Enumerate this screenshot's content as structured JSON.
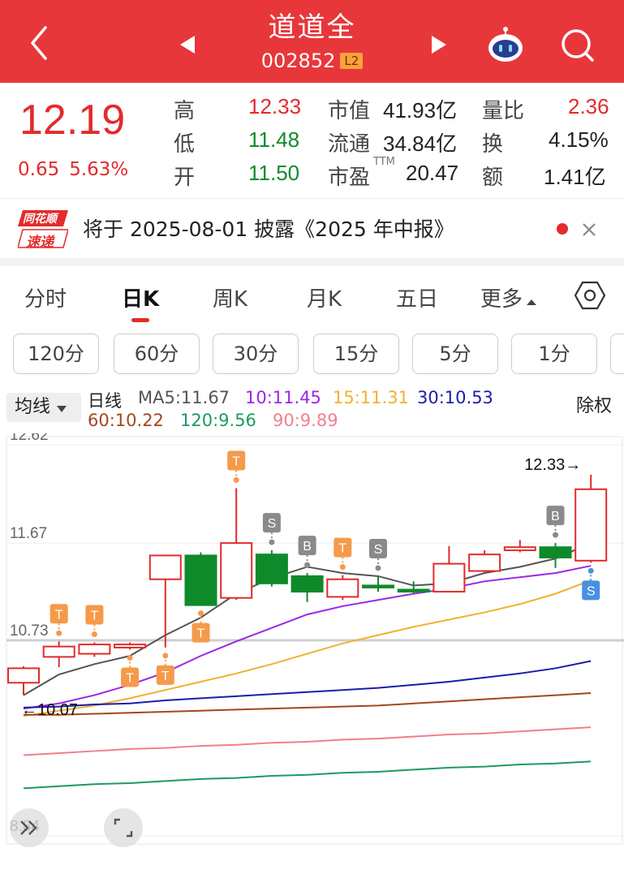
{
  "header": {
    "title": "道道全",
    "code": "002852",
    "badge": "L2",
    "icons": [
      "back-icon",
      "prev-stock-icon",
      "next-stock-icon",
      "robot-assistant-icon",
      "search-icon"
    ]
  },
  "quote": {
    "price": "12.19",
    "change": "0.65",
    "change_pct": "5.63%",
    "high_label": "高",
    "high": "12.33",
    "low_label": "低",
    "low": "11.48",
    "open_label": "开",
    "open": "11.50",
    "mktcap_label": "市值",
    "mktcap": "41.93亿",
    "float_label": "流通",
    "float": "34.84亿",
    "pe_label": "市盈",
    "pe_sup": "TTM",
    "pe": "20.47",
    "volratio_label": "量比",
    "volratio": "2.36",
    "turnover_label": "换",
    "turnover": "4.15%",
    "amount_label": "额",
    "amount": "1.41亿"
  },
  "notice": {
    "logo_top": "同花顺",
    "logo_bottom": "速递",
    "text": "将于 2025-08-01 披露《2025 年中报》"
  },
  "tabs": [
    "分时",
    "日K",
    "周K",
    "月K",
    "五日",
    "更多"
  ],
  "active_tab": "日K",
  "minute_buttons": [
    "120分",
    "60分",
    "30分",
    "15分",
    "5分",
    "1分"
  ],
  "ma_legend": {
    "selector": "均线",
    "line_label": "日线",
    "ma5": "MA5:11.67",
    "ma10": "10:11.45",
    "ma15": "15:11.31",
    "ma30": "30:10.53",
    "ma60": "60:10.22",
    "ma120": "120:9.56",
    "ma90": "90:9.89",
    "adjust": "除权"
  },
  "colors": {
    "header": "#e8373a",
    "up": "#e32b2b",
    "down": "#0f8a2b",
    "ma5": "#555555",
    "ma10": "#9b27e8",
    "ma15": "#f2b12c",
    "ma30": "#1c1ca8",
    "ma60": "#a3471c",
    "ma90": "#f07f8f",
    "ma120": "#1e9a5e"
  },
  "chart_data": {
    "type": "candlestick",
    "y_ticks": [
      "12.62",
      "11.67",
      "10.73",
      "8.84"
    ],
    "ylim": [
      8.84,
      12.62
    ],
    "high_marker": "12.33→",
    "low_marker": "←10.07",
    "candles": [
      {
        "o": 10.32,
        "c": 10.46,
        "h": 10.48,
        "l": 10.2
      },
      {
        "o": 10.57,
        "c": 10.67,
        "h": 10.72,
        "l": 10.47
      },
      {
        "o": 10.6,
        "c": 10.69,
        "h": 10.71,
        "l": 10.57
      },
      {
        "o": 10.66,
        "c": 10.69,
        "h": 10.71,
        "l": 10.64
      },
      {
        "o": 11.32,
        "c": 11.55,
        "h": 11.55,
        "l": 10.66
      },
      {
        "o": 11.55,
        "c": 11.07,
        "h": 11.58,
        "l": 11.07
      },
      {
        "o": 11.14,
        "c": 11.67,
        "h": 12.2,
        "l": 11.12
      },
      {
        "o": 11.56,
        "c": 11.28,
        "h": 11.6,
        "l": 11.25
      },
      {
        "o": 11.35,
        "c": 11.2,
        "h": 11.38,
        "l": 11.1
      },
      {
        "o": 11.15,
        "c": 11.32,
        "h": 11.36,
        "l": 11.12
      },
      {
        "o": 11.26,
        "c": 11.24,
        "h": 11.35,
        "l": 11.2
      },
      {
        "o": 11.22,
        "c": 11.2,
        "h": 11.3,
        "l": 11.18
      },
      {
        "o": 11.2,
        "c": 11.47,
        "h": 11.64,
        "l": 11.2
      },
      {
        "o": 11.4,
        "c": 11.56,
        "h": 11.6,
        "l": 11.38
      },
      {
        "o": 11.6,
        "c": 11.63,
        "h": 11.7,
        "l": 11.58
      },
      {
        "o": 11.63,
        "c": 11.53,
        "h": 11.67,
        "l": 11.43
      },
      {
        "o": 11.5,
        "c": 12.19,
        "h": 12.33,
        "l": 11.48
      }
    ],
    "ma_series": [
      {
        "name": "MA5",
        "values": [
          10.2,
          10.4,
          10.5,
          10.58,
          10.78,
          10.95,
          11.18,
          11.33,
          11.44,
          11.38,
          11.35,
          11.26,
          11.28,
          11.38,
          11.44,
          11.52,
          11.67
        ]
      },
      {
        "name": "10",
        "values": [
          10.07,
          10.12,
          10.2,
          10.3,
          10.42,
          10.58,
          10.72,
          10.85,
          10.98,
          11.06,
          11.12,
          11.18,
          11.23,
          11.3,
          11.34,
          11.38,
          11.45
        ]
      },
      {
        "name": "15",
        "values": [
          10.0,
          10.05,
          10.1,
          10.17,
          10.25,
          10.33,
          10.41,
          10.5,
          10.6,
          10.7,
          10.78,
          10.86,
          10.93,
          11.0,
          11.08,
          11.18,
          11.31
        ]
      },
      {
        "name": "30",
        "values": [
          10.08,
          10.09,
          10.11,
          10.12,
          10.15,
          10.17,
          10.19,
          10.21,
          10.23,
          10.25,
          10.27,
          10.3,
          10.33,
          10.37,
          10.41,
          10.46,
          10.53
        ]
      },
      {
        "name": "60",
        "values": [
          10.01,
          10.01,
          10.02,
          10.03,
          10.04,
          10.05,
          10.06,
          10.07,
          10.08,
          10.09,
          10.1,
          10.12,
          10.14,
          10.16,
          10.18,
          10.2,
          10.22
        ]
      },
      {
        "name": "90",
        "values": [
          9.62,
          9.64,
          9.66,
          9.68,
          9.69,
          9.71,
          9.72,
          9.74,
          9.75,
          9.77,
          9.78,
          9.8,
          9.82,
          9.83,
          9.85,
          9.87,
          9.89
        ]
      },
      {
        "name": "120",
        "values": [
          9.3,
          9.32,
          9.34,
          9.35,
          9.37,
          9.39,
          9.4,
          9.42,
          9.43,
          9.45,
          9.46,
          9.48,
          9.5,
          9.51,
          9.53,
          9.54,
          9.56
        ]
      }
    ],
    "signals": [
      {
        "i": 1,
        "type": "T",
        "pos": "above"
      },
      {
        "i": 2,
        "type": "T",
        "pos": "above"
      },
      {
        "i": 3,
        "type": "T",
        "pos": "below"
      },
      {
        "i": 4,
        "type": "T",
        "pos": "below"
      },
      {
        "i": 5,
        "type": "T",
        "pos": "below"
      },
      {
        "i": 6,
        "type": "T",
        "pos": "above"
      },
      {
        "i": 7,
        "type": "S",
        "pos": "above"
      },
      {
        "i": 8,
        "type": "B",
        "pos": "above"
      },
      {
        "i": 9,
        "type": "T",
        "pos": "above"
      },
      {
        "i": 10,
        "type": "S",
        "pos": "above"
      },
      {
        "i": 15,
        "type": "B",
        "pos": "above"
      },
      {
        "i": 16,
        "type": "S",
        "pos": "below"
      }
    ]
  }
}
